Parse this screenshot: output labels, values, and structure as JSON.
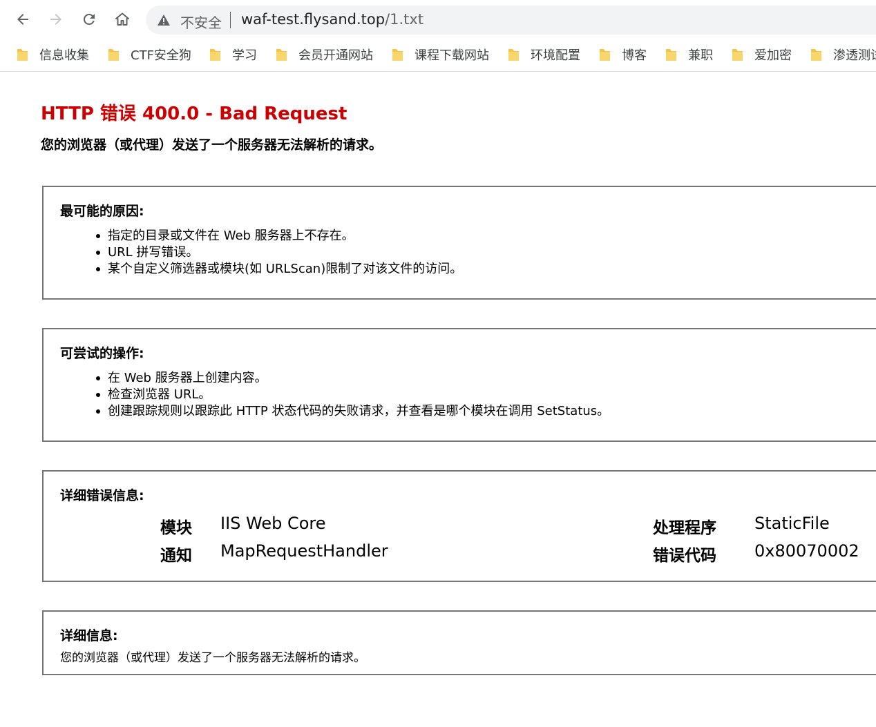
{
  "browser": {
    "security_label": "不安全",
    "url_host": "waf-test.flysand.top",
    "url_path": "/1.txt",
    "bookmarks": [
      {
        "label": "信息收集"
      },
      {
        "label": "CTF安全狗"
      },
      {
        "label": "学习"
      },
      {
        "label": "会员开通网站"
      },
      {
        "label": "课程下载网站"
      },
      {
        "label": "环境配置"
      },
      {
        "label": "博客"
      },
      {
        "label": "兼职"
      },
      {
        "label": "爱加密"
      },
      {
        "label": "渗透测试"
      }
    ],
    "folder_color": "#f6c344"
  },
  "page": {
    "title": "HTTP 错误 400.0 - Bad Request",
    "subtitle": "您的浏览器（或代理）发送了一个服务器无法解析的请求。",
    "title_color": "#cc0000",
    "causes": {
      "heading": "最可能的原因:",
      "items": [
        "指定的目录或文件在 Web 服务器上不存在。",
        "URL 拼写错误。",
        "某个自定义筛选器或模块(如 URLScan)限制了对该文件的访问。"
      ]
    },
    "actions": {
      "heading": "可尝试的操作:",
      "items": [
        "在 Web 服务器上创建内容。",
        "检查浏览器 URL。",
        "创建跟踪规则以跟踪此 HTTP 状态代码的失败请求，并查看是哪个模块在调用 SetStatus。"
      ]
    },
    "detailed_error": {
      "heading": "详细错误信息:",
      "module_label": "模块",
      "module_value": "IIS Web Core",
      "notification_label": "通知",
      "notification_value": "MapRequestHandler",
      "handler_label": "处理程序",
      "handler_value": "StaticFile",
      "error_code_label": "错误代码",
      "error_code_value": "0x80070002"
    },
    "more_info": {
      "heading": "详细信息:",
      "text": "您的浏览器（或代理）发送了一个服务器无法解析的请求。"
    }
  }
}
